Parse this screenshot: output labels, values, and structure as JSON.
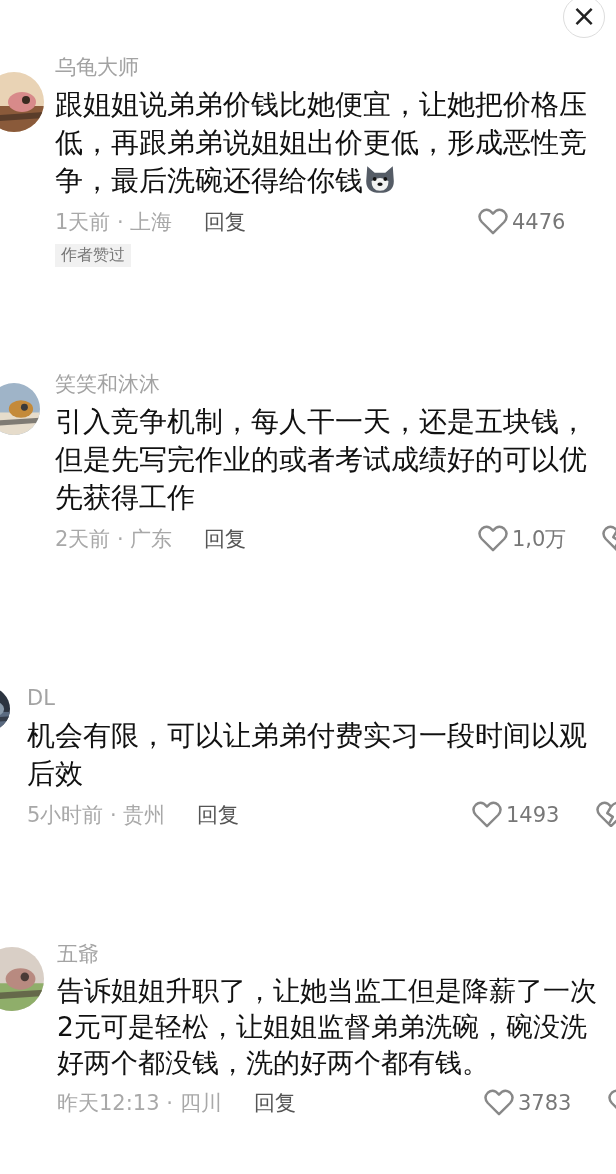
{
  "close_button": {
    "label": "×"
  },
  "comments": [
    {
      "author": "乌龟大师",
      "text": "跟姐姐说弟弟价钱比她便宜，让她把价格压低，再跟弟弟说姐姐出价更低，形成恶性竞争，最后洗碗还得给你钱",
      "emoji": true,
      "time": "1天前 · 上海",
      "reply": "回复",
      "likes": "4476",
      "dislike": false,
      "badge": "作者赞过"
    },
    {
      "author": "笑笑和沐沐",
      "text": "引入竞争机制，每人干一天，还是五块钱，但是先写完作业的或者考试成绩好的可以优先获得工作",
      "emoji": false,
      "time": "2天前 · 广东",
      "reply": "回复",
      "likes": "1,0万",
      "dislike": true
    },
    {
      "author": "DL",
      "text": "机会有限，可以让弟弟付费实习一段时间以观后效",
      "emoji": false,
      "time": "5小时前 · 贵州",
      "reply": "回复",
      "likes": "1493",
      "dislike": true
    },
    {
      "author": "五爺",
      "text": "告诉姐姐升职了，让她当监工但是降薪了一次2元可是轻松，让姐姐监督弟弟洗碗，碗没洗好两个都没钱，洗的好两个都有钱。",
      "emoji": false,
      "time": "昨天12:13 · 四川",
      "reply": "回复",
      "likes": "3783",
      "dislike": true
    }
  ]
}
